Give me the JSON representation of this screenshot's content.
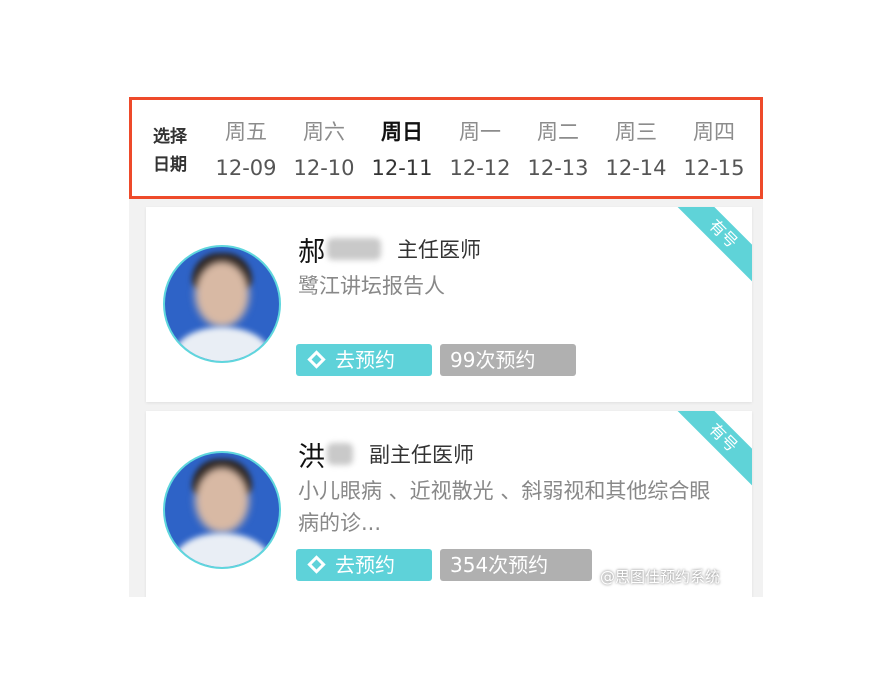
{
  "date_picker": {
    "label_line1": "选择",
    "label_line2": "日期",
    "days": [
      {
        "weekday": "周五",
        "date": "12-09"
      },
      {
        "weekday": "周六",
        "date": "12-10"
      },
      {
        "weekday": "周日",
        "date": "12-11"
      },
      {
        "weekday": "周一",
        "date": "12-12"
      },
      {
        "weekday": "周二",
        "date": "12-13"
      },
      {
        "weekday": "周三",
        "date": "12-14"
      },
      {
        "weekday": "周四",
        "date": "12-15"
      }
    ],
    "selected_weekday": "周日"
  },
  "doctors": [
    {
      "surname": "郝",
      "title": "主任医师",
      "description": "鹭江讲坛报告人",
      "book_label": "去预约",
      "appointments": "99次预约",
      "badge": "有号"
    },
    {
      "surname": "洪",
      "title": "副主任医师",
      "description": "小儿眼病 、近视散光 、斜弱视和其他综合眼病的诊...",
      "book_label": "去预约",
      "appointments": "354次预约",
      "badge": "有号"
    }
  ],
  "watermark": "@思图佳预约系统",
  "colors": {
    "highlight_border": "#ee4a2a",
    "accent_teal": "#5ed2d9",
    "count_gray": "#b0b0b0"
  }
}
